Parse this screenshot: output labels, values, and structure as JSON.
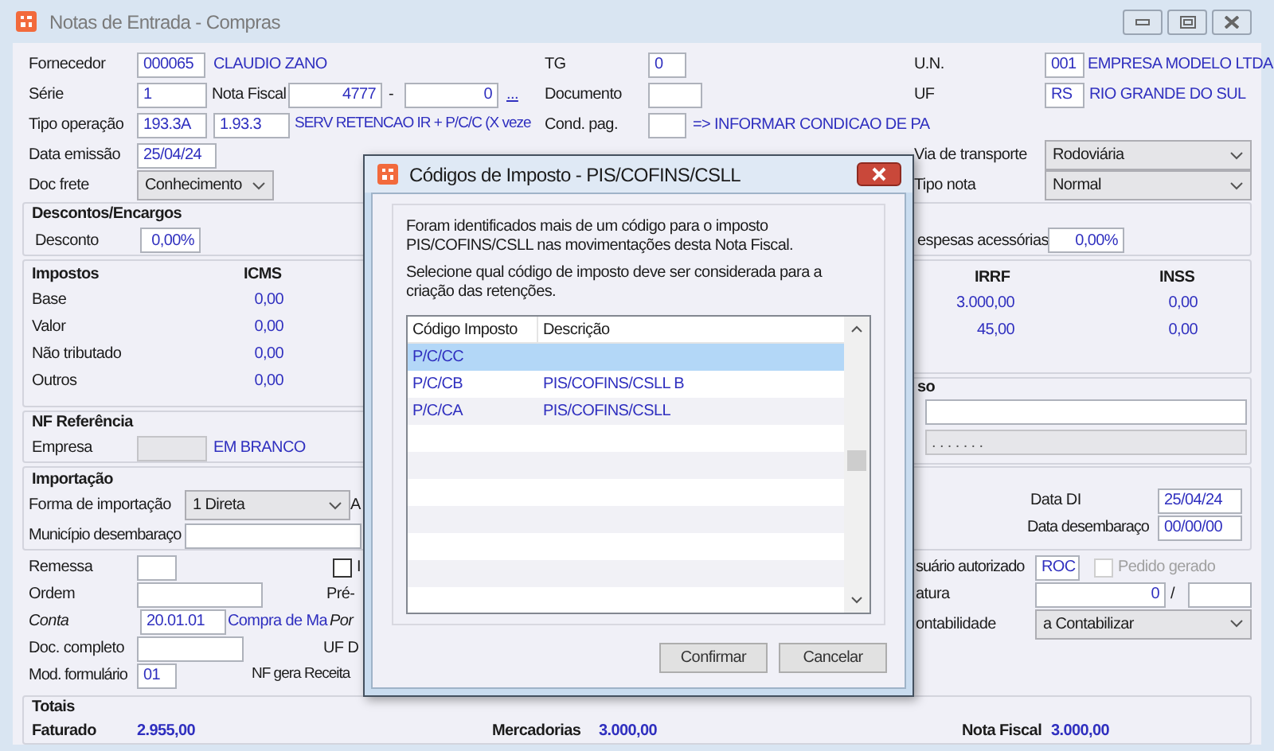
{
  "window": {
    "title": "Notas de Entrada - Compras"
  },
  "top_rows": [
    [
      {
        "kind": "label",
        "text": "Fornecedor"
      },
      {
        "kind": "field",
        "value": "000065"
      },
      {
        "kind": "text",
        "text": "CLAUDIO ZANO"
      },
      {
        "kind": "label",
        "text": "TG"
      },
      {
        "kind": "field",
        "value": "0"
      },
      {
        "kind": "label",
        "text": "U.N."
      },
      {
        "kind": "field",
        "value": "001"
      },
      {
        "kind": "text",
        "text": "EMPRESA MODELO LTDA"
      }
    ],
    [
      {
        "kind": "label",
        "text": "Série"
      },
      {
        "kind": "field",
        "value": "1"
      },
      {
        "kind": "label",
        "text": "Nota Fiscal"
      },
      {
        "kind": "field",
        "value": "4777"
      },
      {
        "kind": "sep",
        "text": "-"
      },
      {
        "kind": "field",
        "value": "0"
      },
      {
        "kind": "link",
        "text": "..."
      },
      {
        "kind": "label",
        "text": "Documento"
      },
      {
        "kind": "field"
      },
      {
        "kind": "label",
        "text": "UF"
      },
      {
        "kind": "field",
        "value": "RS"
      },
      {
        "kind": "text",
        "text": "RIO GRANDE DO SUL"
      }
    ],
    [
      {
        "kind": "label",
        "text": "Tipo operação"
      },
      {
        "kind": "field",
        "value": "193.3A"
      },
      {
        "kind": "field",
        "value": "1.93.3"
      },
      {
        "kind": "text",
        "text": "SERV RETENCAO IR + P/C/C (X veze"
      },
      {
        "kind": "label",
        "text": "Cond. pag."
      },
      {
        "kind": "field"
      },
      {
        "kind": "text",
        "text": "=> INFORMAR CONDICAO DE PA"
      }
    ],
    [
      {
        "kind": "label",
        "text": "Data emissão"
      },
      {
        "kind": "field",
        "value": "25/04/24"
      },
      {
        "kind": "label",
        "text": "Via de transporte"
      },
      {
        "kind": "select",
        "value": "Rodoviária"
      }
    ],
    [
      {
        "kind": "label",
        "text": "Doc frete"
      },
      {
        "kind": "select",
        "value": "Conhecimento"
      },
      {
        "kind": "label",
        "text": "Tipo nota"
      },
      {
        "kind": "select",
        "value": "Normal"
      }
    ]
  ],
  "left_groups": [
    {
      "rows": [
        [
          {
            "kind": "heading",
            "text": "Descontos/Encargos"
          }
        ],
        [
          {
            "kind": "label",
            "text": "Desconto"
          },
          {
            "kind": "field",
            "value": "0,00%"
          }
        ]
      ]
    },
    {
      "rows": [
        [
          {
            "kind": "heading",
            "text": "Impostos"
          },
          {
            "kind": "heading",
            "text": "ICMS"
          }
        ],
        [
          {
            "kind": "label",
            "text": "Base"
          },
          {
            "kind": "text",
            "text": "0,00"
          }
        ],
        [
          {
            "kind": "label",
            "text": "Valor"
          },
          {
            "kind": "text",
            "text": "0,00"
          }
        ],
        [
          {
            "kind": "label",
            "text": "Não tributado"
          },
          {
            "kind": "text",
            "text": "0,00"
          }
        ],
        [
          {
            "kind": "label",
            "text": "Outros"
          },
          {
            "kind": "text",
            "text": "0,00"
          }
        ]
      ]
    },
    {
      "rows": [
        [
          {
            "kind": "heading",
            "text": "NF Referência"
          }
        ],
        [
          {
            "kind": "label",
            "text": "Empresa"
          },
          {
            "kind": "field",
            "disabled": true
          },
          {
            "kind": "text",
            "text": "EM BRANCO"
          }
        ]
      ]
    },
    {
      "rows": [
        [
          {
            "kind": "heading",
            "text": "Importação"
          }
        ],
        [
          {
            "kind": "label",
            "text": "Forma de importação"
          },
          {
            "kind": "select",
            "value": "1 Direta"
          },
          {
            "kind": "label",
            "text": "A"
          }
        ],
        [
          {
            "kind": "label",
            "text": "Município desembaraço"
          },
          {
            "kind": "field"
          }
        ]
      ]
    },
    {
      "rows": [
        [
          {
            "kind": "label",
            "text": "Remessa"
          },
          {
            "kind": "field"
          },
          {
            "kind": "checkbox",
            "text": "I",
            "checked": false
          }
        ],
        [
          {
            "kind": "label",
            "text": "Ordem"
          },
          {
            "kind": "field"
          },
          {
            "kind": "label",
            "text": "Pré-"
          }
        ],
        [
          {
            "kind": "label",
            "text": "Conta",
            "italic": true
          },
          {
            "kind": "field",
            "value": "20.01.01"
          },
          {
            "kind": "text",
            "text": "Compra de Ma"
          },
          {
            "kind": "label",
            "text": "Por",
            "italic": true
          }
        ],
        [
          {
            "kind": "label",
            "text": "Doc. completo"
          },
          {
            "kind": "field"
          },
          {
            "kind": "label",
            "text": "UF D"
          }
        ],
        [
          {
            "kind": "label",
            "text": "Mod. formulário"
          },
          {
            "kind": "field",
            "value": "01"
          },
          {
            "kind": "label",
            "text": "NF gera Receita"
          }
        ]
      ]
    }
  ],
  "right_groups": [
    {
      "rows": [
        [
          {
            "kind": "label",
            "text": "espesas acessórias"
          },
          {
            "kind": "field",
            "value": "0,00%"
          }
        ]
      ]
    },
    {
      "rows": [
        [
          {
            "kind": "heading",
            "text": "IRRF"
          },
          {
            "kind": "heading",
            "text": "INSS"
          }
        ],
        [
          {
            "kind": "text",
            "text": "3.000,00"
          },
          {
            "kind": "text",
            "text": "0,00"
          }
        ],
        [
          {
            "kind": "text",
            "text": "45,00"
          },
          {
            "kind": "text",
            "text": "0,00"
          }
        ]
      ]
    },
    {
      "rows": [
        [
          {
            "kind": "heading",
            "text": "so"
          }
        ],
        [
          {
            "kind": "field"
          }
        ],
        [
          {
            "kind": "field",
            "value": ". . . . . . .",
            "disabled": true
          }
        ]
      ]
    },
    {
      "rows": [
        [
          {
            "kind": "label",
            "text": "Data DI"
          },
          {
            "kind": "field",
            "value": "25/04/24"
          }
        ],
        [
          {
            "kind": "label",
            "text": "Data desembaraço"
          },
          {
            "kind": "field",
            "value": "00/00/00"
          }
        ]
      ]
    },
    {
      "checkbox": {
        "kind": "checkbox",
        "text": "Pedido gerado",
        "checked": false,
        "disabled": true
      },
      "rows": [
        [
          {
            "kind": "label",
            "text": "suário autorizado"
          },
          {
            "kind": "field",
            "value": "ROC"
          }
        ],
        [
          {
            "kind": "label",
            "text": "atura"
          },
          {
            "kind": "field",
            "value": "0"
          },
          {
            "kind": "sep",
            "text": "/"
          },
          {
            "kind": "field"
          }
        ],
        [
          {
            "kind": "label",
            "text": "ontabilidade"
          },
          {
            "kind": "select",
            "value": "a Contabilizar"
          }
        ]
      ]
    }
  ],
  "totals": {
    "rows": [
      [
        {
          "kind": "heading",
          "text": "Totais"
        }
      ],
      [
        {
          "kind": "heading",
          "text": "Faturado"
        },
        {
          "kind": "total",
          "text": "2.955,00"
        },
        {
          "kind": "heading",
          "text": "Mercadorias"
        },
        {
          "kind": "total",
          "text": "3.000,00"
        },
        {
          "kind": "heading",
          "text": "Nota Fiscal"
        },
        {
          "kind": "total",
          "text": "3.000,00"
        }
      ]
    ]
  },
  "dialog": {
    "title": "Códigos de Imposto - PIS/COFINS/CSLL",
    "messages": [
      "Foram identificados mais de um código para o imposto PIS/COFINS/CSLL nas movimentações desta Nota Fiscal.",
      "Selecione qual código de imposto deve ser considerada para a criação das retenções."
    ],
    "columns": [
      "Código Imposto",
      "Descrição"
    ],
    "rows": [
      {
        "code": "P/C/CC",
        "selected": true
      },
      {
        "code": "P/C/CB",
        "description": "PIS/COFINS/CSLL B",
        "selected": false
      },
      {
        "code": "P/C/CA",
        "description": "PIS/COFINS/CSLL",
        "selected": false
      }
    ],
    "buttons": [
      "Confirmar",
      "Cancelar"
    ]
  }
}
